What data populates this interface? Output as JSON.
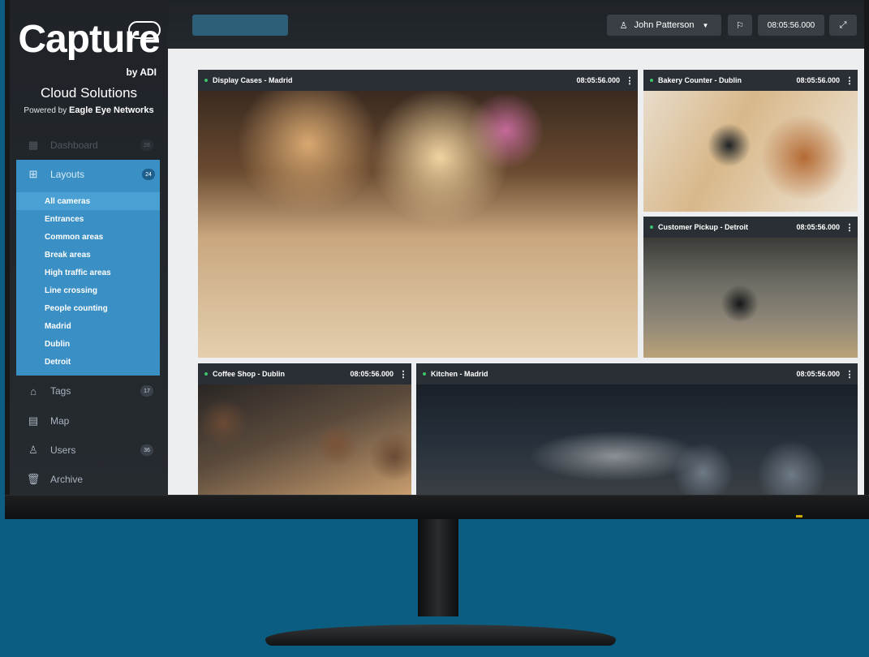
{
  "brand": {
    "logo_text": "Capture",
    "logo_by": "by ADI",
    "subtitle": "Cloud Solutions",
    "powered_prefix": "Powered by",
    "powered_name": "Eagle Eye Networks"
  },
  "sidebar": {
    "dashboard": {
      "label": "Dashboard",
      "count": "28"
    },
    "layouts": {
      "label": "Layouts",
      "count": "24"
    },
    "layout_items": [
      "All cameras",
      "Entrances",
      "Common areas",
      "Break areas",
      "High traffic areas",
      "Line crossing",
      "People counting",
      "Madrid",
      "Dublin",
      "Detroit"
    ],
    "tags": {
      "label": "Tags",
      "count": "17"
    },
    "map": {
      "label": "Map"
    },
    "users": {
      "label": "Users",
      "count": "36"
    },
    "archive": {
      "label": "Archive"
    }
  },
  "topbar": {
    "user_name": "John Patterson",
    "time": "08:05:56.000"
  },
  "cameras": [
    {
      "title": "Display Cases - Madrid",
      "time": "08:05:56.000"
    },
    {
      "title": "Bakery Counter - Dublin",
      "time": "08:05:56.000"
    },
    {
      "title": "Customer Pickup - Detroit",
      "time": "08:05:56.000"
    },
    {
      "title": "Coffee Shop - Dublin",
      "time": "08:05:56.000"
    },
    {
      "title": "Kitchen - Madrid",
      "time": "08:05:56.000"
    }
  ],
  "colors": {
    "background": "#0b5e82",
    "accent": "#3a8fc4",
    "active_item": "#4aa0d2",
    "live_dot": "#3cc36e"
  }
}
